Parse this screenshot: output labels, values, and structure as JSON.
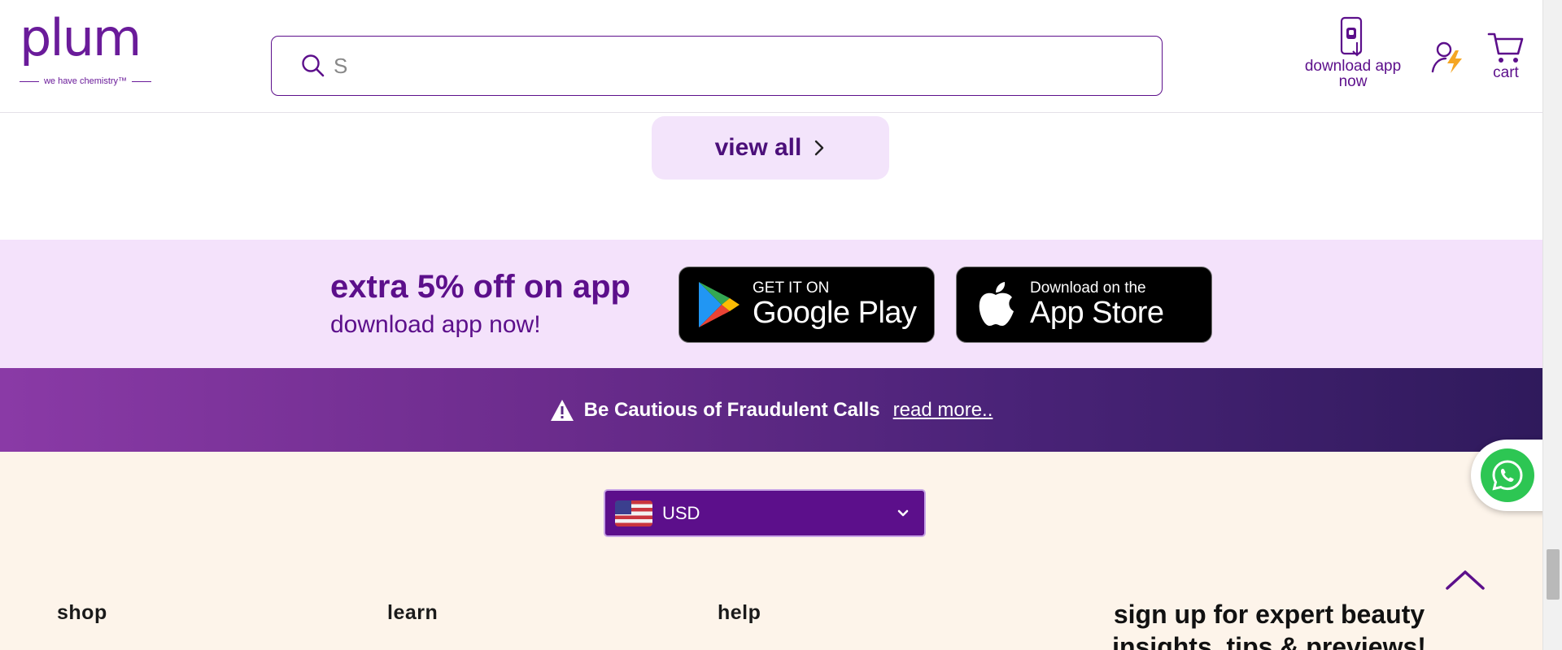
{
  "header": {
    "logo_text": "plum",
    "logo_tagline": "we have chemistry™",
    "search": {
      "value": "S",
      "icon": "search-icon"
    },
    "download_app_label": "download app now",
    "cart_label": "cart",
    "account_icon": "account-lightning-icon"
  },
  "view_all": {
    "label": "view all",
    "icon": "chevron-right-icon"
  },
  "app_banner": {
    "title": "extra 5% off on app",
    "subtitle": "download app now!",
    "google_play": {
      "small": "GET IT ON",
      "big": "Google Play"
    },
    "app_store": {
      "small": "Download on the",
      "big": "App Store"
    }
  },
  "fraud_notice": {
    "text": "Be Cautious of Fraudulent Calls",
    "link": "read more.."
  },
  "footer": {
    "currency": {
      "selected": "USD",
      "flag": "us-flag-icon"
    },
    "columns": [
      {
        "title": "shop"
      },
      {
        "title": "learn"
      },
      {
        "title": "help"
      }
    ],
    "signup_title": "sign up for expert beauty insights, tips & previews!"
  },
  "colors": {
    "brand_purple": "#5c0f8b",
    "banner_bg": "#f4e2fb",
    "footer_bg": "#fdf4ea",
    "whatsapp_green": "#2dc653"
  }
}
